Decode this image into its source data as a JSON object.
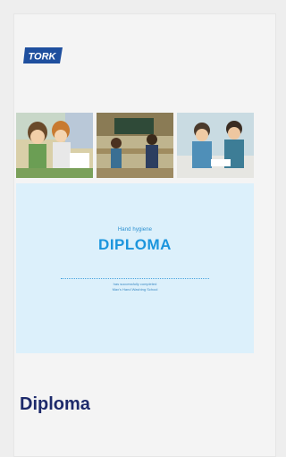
{
  "brand": {
    "logo_text": "TORK",
    "logo_color": "#1f4f9e"
  },
  "images": [
    {
      "name": "illustration-panel-1",
      "description_icon": "kids-washing-hands-scene"
    },
    {
      "name": "illustration-panel-2",
      "description_icon": "classroom-scene"
    },
    {
      "name": "illustration-panel-3",
      "description_icon": "washroom-scene"
    }
  ],
  "diploma": {
    "eyebrow": "Hand hygiene",
    "title": "DIPLOMA",
    "line1": "has successfully completed",
    "line2": "Max's Hand Washing School",
    "background": "#dcf0fb",
    "accent": "#1b95dd"
  },
  "card": {
    "title": "Diploma",
    "title_color": "#1d2a6b"
  }
}
